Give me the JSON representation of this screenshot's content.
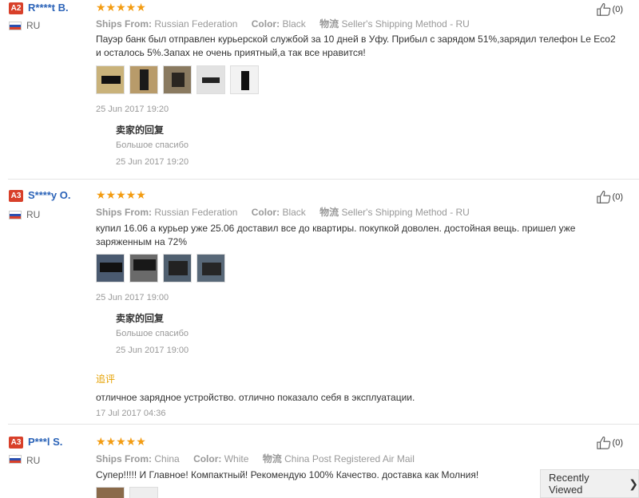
{
  "reviews": [
    {
      "level": "A2",
      "name": "R****t B.",
      "country": "RU",
      "stars": "★★★★★",
      "ships_from_label": "Ships From:",
      "ships_from": "Russian Federation",
      "color_label": "Color:",
      "color": "Black",
      "shipping_label": "物流",
      "shipping": "Seller's Shipping Method - RU",
      "text": "Пауэр банк был отправлен курьерской службой за 10 дней в Уфу. Прибыл с зарядом 51%,зарядил телефон Le Eco2 и осталось 5%.Запах не очень приятный,а так все нравится!",
      "date": "25 Jun 2017 19:20",
      "reply_title": "卖家的回复",
      "reply_text": "Большое спасибо",
      "reply_date": "25 Jun 2017 19:20",
      "helpful": "(0)"
    },
    {
      "level": "A3",
      "name": "S****y O.",
      "country": "RU",
      "stars": "★★★★★",
      "ships_from_label": "Ships From:",
      "ships_from": "Russian Federation",
      "color_label": "Color:",
      "color": "Black",
      "shipping_label": "物流",
      "shipping": "Seller's Shipping Method - RU",
      "text": "купил 16.06 а курьер уже 25.06 доставил все до квартиры. покупкой доволен. достойная вещь. пришел уже заряженным на 72%",
      "date": "25 Jun 2017 19:00",
      "reply_title": "卖家的回复",
      "reply_text": "Большое спасибо",
      "reply_date": "25 Jun 2017 19:00",
      "followup_label": "追评",
      "followup_text": "отличное зарядное устройство. отлично показало себя в эксплуатации.",
      "followup_date": "17 Jul 2017 04:36",
      "helpful": "(0)"
    },
    {
      "level": "A3",
      "name": "P***l S.",
      "country": "RU",
      "stars": "★★★★★",
      "ships_from_label": "Ships From:",
      "ships_from": "China",
      "color_label": "Color:",
      "color": "White",
      "shipping_label": "物流",
      "shipping": "China Post Registered Air Mail",
      "text": "Супер!!!!! И Главное! Компактный! Рекомендую 100% Качество. доставка как Молния!",
      "helpful": "(0)"
    }
  ],
  "recently_viewed": {
    "label": "Recently Viewed",
    "chevron": "❯"
  },
  "colors": {
    "accent_star": "#f39c12",
    "name_link": "#2b63b8",
    "level_badge": "#d8402a",
    "followup": "#e6a100"
  }
}
